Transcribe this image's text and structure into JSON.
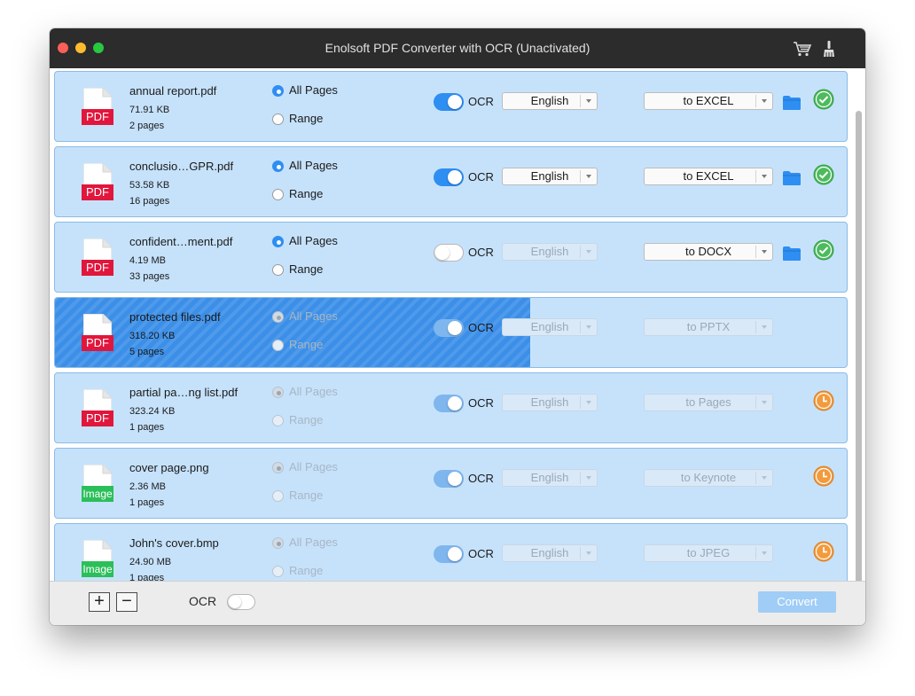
{
  "window": {
    "title": "Enolsoft PDF Converter with OCR (Unactivated)"
  },
  "toolbar": {
    "icons": [
      "cart-icon",
      "brush-icon"
    ]
  },
  "colors": {
    "accent": "#2e8ef2",
    "row_bg": "#c6e2fb",
    "pdf_badge": "#e1163c",
    "image_badge": "#2bbf5a",
    "done": "#4cbb5d",
    "pending": "#f39a3c"
  },
  "files": [
    {
      "name": "annual report.pdf",
      "size": "71.91 KB",
      "pages": "2 pages",
      "badge": "PDF",
      "kind": "pdf",
      "pages_mode": "all",
      "all_pages_label": "All Pages",
      "range_label": "Range",
      "ocr": true,
      "ocr_label": "OCR",
      "language": "English",
      "format": "to EXCEL",
      "status": "done",
      "enabled": true
    },
    {
      "name": "conclusio…GPR.pdf",
      "size": "53.58 KB",
      "pages": "16 pages",
      "badge": "PDF",
      "kind": "pdf",
      "pages_mode": "all",
      "all_pages_label": "All Pages",
      "range_label": "Range",
      "ocr": true,
      "ocr_label": "OCR",
      "language": "English",
      "format": "to EXCEL",
      "status": "done",
      "enabled": true
    },
    {
      "name": "confident…ment.pdf",
      "size": "4.19 MB",
      "pages": "33 pages",
      "badge": "PDF",
      "kind": "pdf",
      "pages_mode": "all",
      "all_pages_label": "All Pages",
      "range_label": "Range",
      "ocr": false,
      "ocr_label": "OCR",
      "language": "English",
      "format": "to DOCX",
      "status": "done",
      "enabled": true
    },
    {
      "name": "protected files.pdf",
      "size": "318.20 KB",
      "pages": "5 pages",
      "badge": "PDF",
      "kind": "pdf",
      "pages_mode": "all",
      "all_pages_label": "All Pages",
      "range_label": "Range",
      "ocr": true,
      "ocr_label": "OCR",
      "language": "English",
      "format": "to PPTX",
      "status": "converting",
      "progress": 0.6,
      "enabled": false
    },
    {
      "name": "partial pa…ng list.pdf",
      "size": "323.24 KB",
      "pages": "1 pages",
      "badge": "PDF",
      "kind": "pdf",
      "pages_mode": "all",
      "all_pages_label": "All Pages",
      "range_label": "Range",
      "ocr": true,
      "ocr_label": "OCR",
      "language": "English",
      "format": "to Pages",
      "status": "pending",
      "enabled": false
    },
    {
      "name": "cover page.png",
      "size": "2.36 MB",
      "pages": "1 pages",
      "badge": "Image",
      "kind": "image",
      "pages_mode": "all",
      "all_pages_label": "All Pages",
      "range_label": "Range",
      "ocr": true,
      "ocr_label": "OCR",
      "language": "English",
      "format": "to Keynote",
      "status": "pending",
      "enabled": false
    },
    {
      "name": "John's cover.bmp",
      "size": "24.90 MB",
      "pages": "1 pages",
      "badge": "Image",
      "kind": "image",
      "pages_mode": "all",
      "all_pages_label": "All Pages",
      "range_label": "Range",
      "ocr": true,
      "ocr_label": "OCR",
      "language": "English",
      "format": "to JPEG",
      "status": "pending",
      "enabled": false
    }
  ],
  "bottom": {
    "add_label": "+",
    "remove_label": "−",
    "ocr_label": "OCR",
    "ocr_enabled": false,
    "convert_label": "Convert"
  }
}
